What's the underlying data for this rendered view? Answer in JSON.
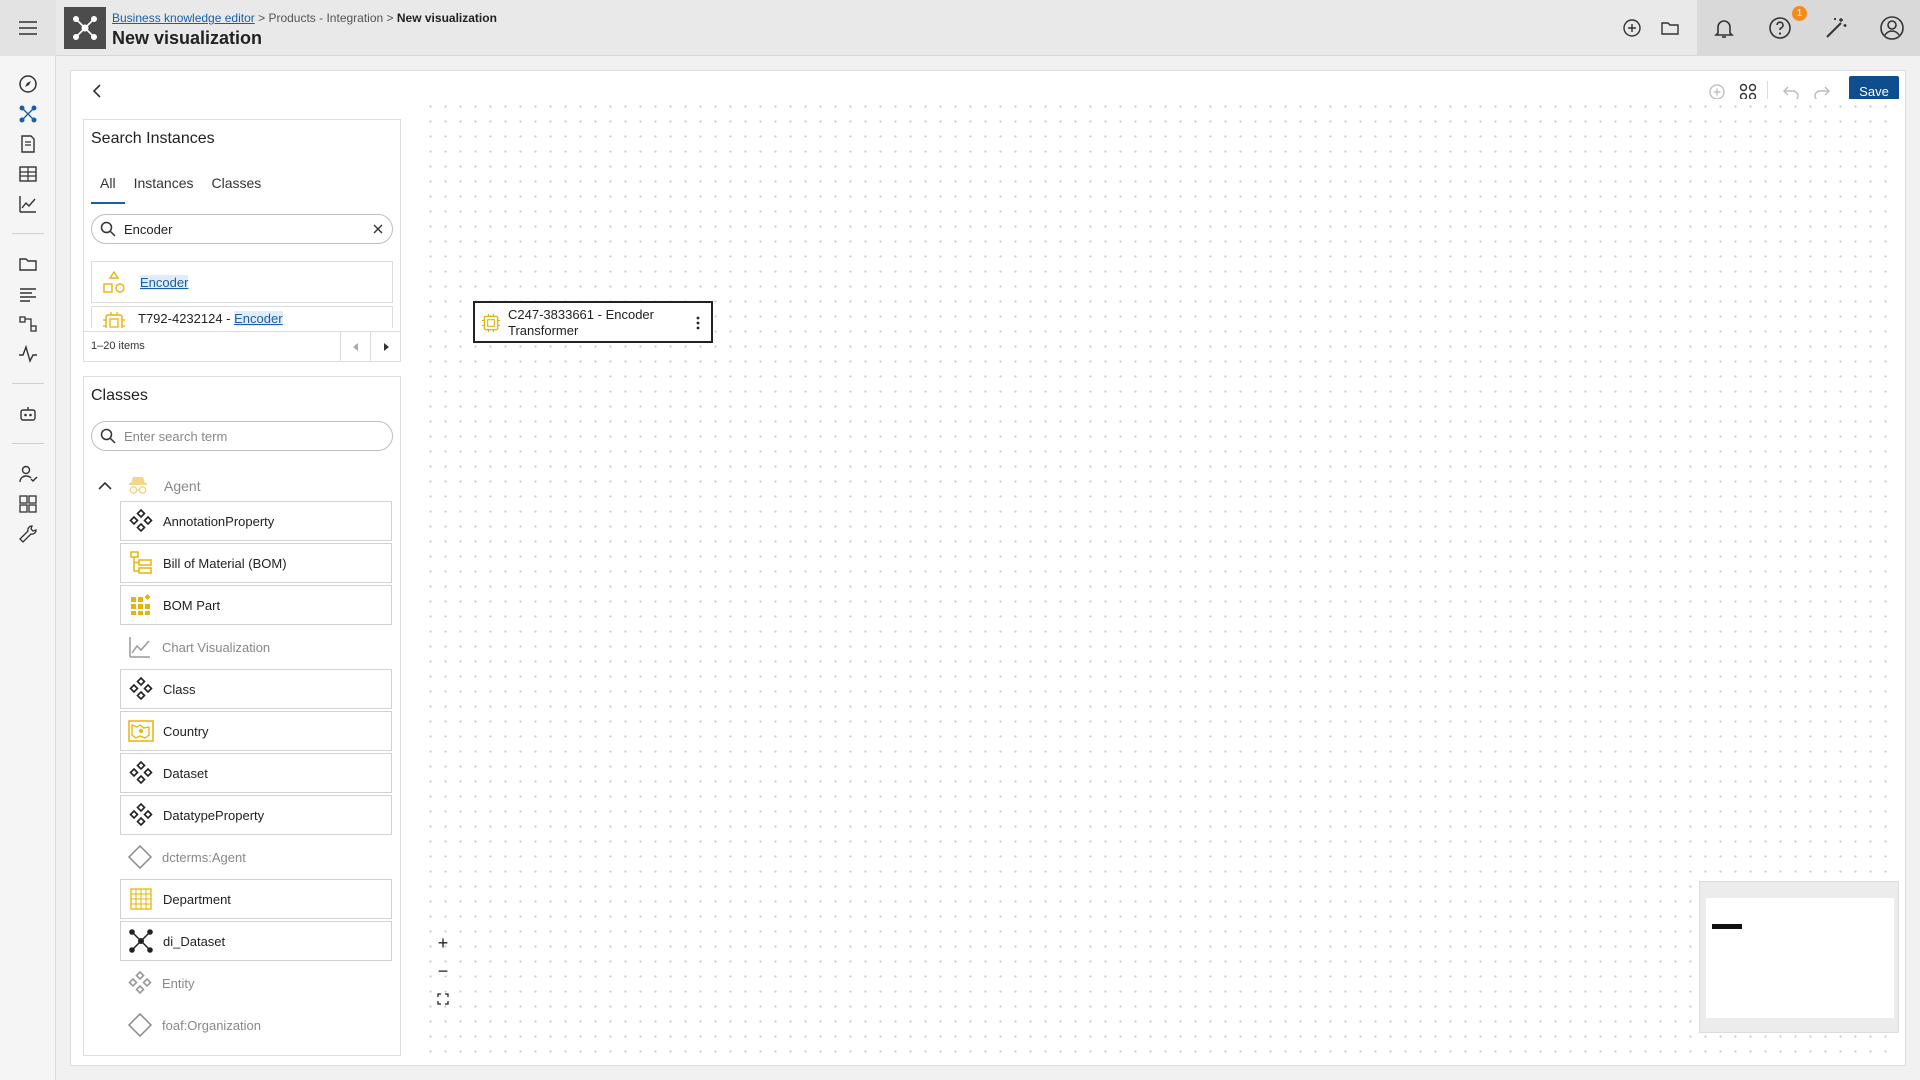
{
  "header": {
    "breadcrumb": {
      "link": "Business knowledge editor",
      "sep1": " > ",
      "middle": "Products - Integration",
      "sep2": " > ",
      "current": "New visualization"
    },
    "title": "New visualization",
    "notification_count": "1"
  },
  "toolbar": {
    "save_label": "Save"
  },
  "search_panel": {
    "title": "Search Instances",
    "tabs": [
      {
        "label": "All"
      },
      {
        "label": "Instances"
      },
      {
        "label": "Classes"
      }
    ],
    "search_value": "Encoder",
    "results": [
      {
        "label": "Encoder",
        "icon": "shapes-icon"
      },
      {
        "prefix": "T792-4232124 - ",
        "match": "Encoder",
        "icon": "chip-icon"
      }
    ],
    "pagination": "1–20 items"
  },
  "classes_panel": {
    "title": "Classes",
    "search_placeholder": "Enter search term",
    "group": {
      "label": "Agent",
      "icon": "agent-icon"
    },
    "items": [
      {
        "label": "AnnotationProperty",
        "icon": "diamond-cluster-icon"
      },
      {
        "label": "Bill of Material (BOM)",
        "icon": "bom-tree-icon"
      },
      {
        "label": "BOM Part",
        "icon": "bom-part-icon"
      },
      {
        "label": "Chart Visualization",
        "icon": "chart-icon"
      },
      {
        "label": "Class",
        "icon": "diamond-cluster-icon"
      },
      {
        "label": "Country",
        "icon": "country-icon"
      },
      {
        "label": "Dataset",
        "icon": "diamond-cluster-icon"
      },
      {
        "label": "DatatypeProperty",
        "icon": "diamond-cluster-icon"
      },
      {
        "label": "dcterms:Agent",
        "icon": "diamond-outline-icon"
      },
      {
        "label": "Department",
        "icon": "grid-icon"
      },
      {
        "label": "di_Dataset",
        "icon": "network-icon"
      },
      {
        "label": "Entity",
        "icon": "diamond-cluster-icon"
      },
      {
        "label": "foaf:Organization",
        "icon": "diamond-outline-icon"
      }
    ]
  },
  "canvas": {
    "node": {
      "line1": "C247-3833661 - Encoder",
      "line2": "Transformer",
      "icon": "chip-icon"
    },
    "zoom_in": "+",
    "zoom_out": "−"
  },
  "colors": {
    "accent": "#0e4e8f",
    "link": "#1a5ea8",
    "icon_yellow": "#e8b40a",
    "badge": "#f28c1e"
  }
}
